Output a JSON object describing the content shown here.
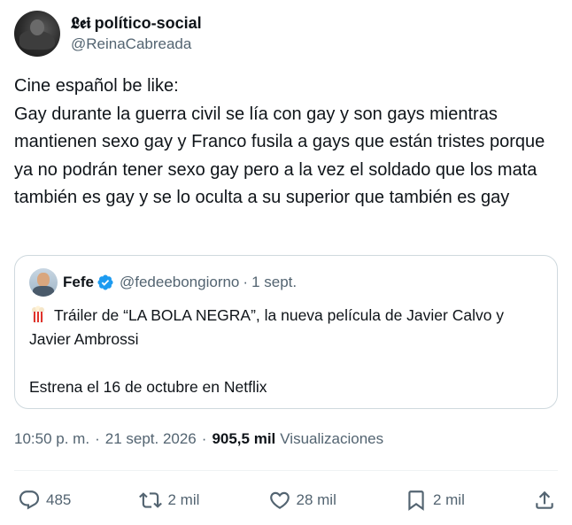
{
  "author": {
    "logo_glyph": "𝕷𝖊𝖎",
    "display_name": "político-social",
    "handle": "@ReinaCabreada"
  },
  "tweet": {
    "line1": "Cine español be like:",
    "line2": "Gay durante la guerra civil se lía con gay y son gays mientras mantienen sexo gay y Franco fusila a gays que están tristes porque ya no podrán tener sexo gay pero a la vez el soldado que los mata también es gay y se lo oculta a su superior que también es gay"
  },
  "quote": {
    "name": "Fefe",
    "handle": "@fedeebongiorno",
    "dot": "·",
    "date": "1 sept.",
    "text1": "Tráiler de “LA BOLA NEGRA”, la nueva película de Javier Calvo y Javier Ambrossi",
    "text2": "Estrena el 16 de octubre en Netflix",
    "popcorn_icon": "popcorn-icon"
  },
  "meta": {
    "time": "10:50 p. m.",
    "sep1": "·",
    "date": "21 sept. 2026",
    "sep2": "·",
    "views_count": "905,5 mil",
    "views_label": "Visualizaciones"
  },
  "actions": {
    "replies": "485",
    "retweets": "2 mil",
    "likes": "28 mil",
    "bookmarks": "2 mil"
  },
  "colors": {
    "text": "#0f1419",
    "muted": "#536471",
    "border": "#cfd9de",
    "verified": "#1d9bf0"
  }
}
